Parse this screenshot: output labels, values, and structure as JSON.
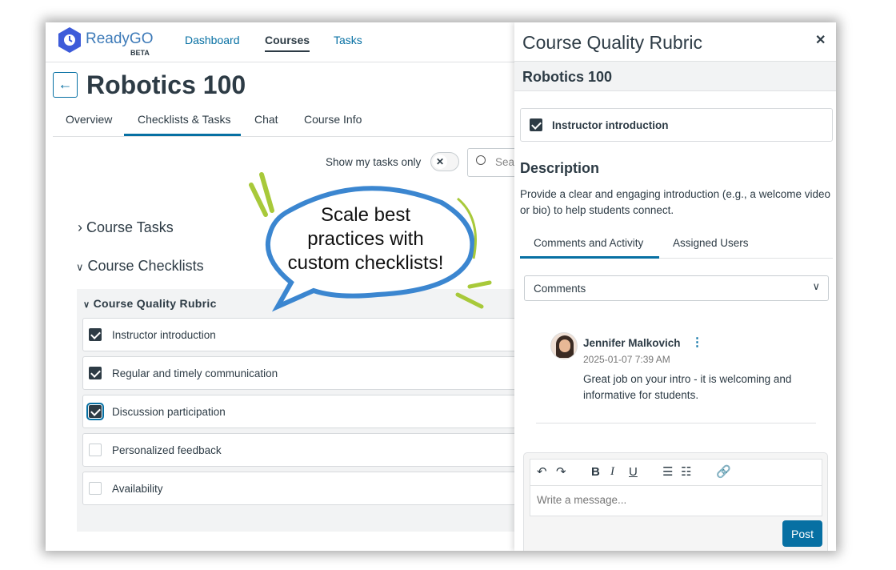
{
  "app": {
    "name": "ReadyGO",
    "badge": "BETA",
    "accent": "#0770a3"
  },
  "nav": [
    {
      "label": "Dashboard"
    },
    {
      "label": "Courses",
      "active": true
    },
    {
      "label": "Tasks"
    }
  ],
  "course": {
    "title": "Robotics 100",
    "back_icon": "arrow-left-icon"
  },
  "tabs": [
    {
      "label": "Overview"
    },
    {
      "label": "Checklists & Tasks",
      "active": true
    },
    {
      "label": "Chat"
    },
    {
      "label": "Course Info"
    }
  ],
  "filter": {
    "toggle_label": "Show my tasks only",
    "toggle_on": false,
    "search_placeholder": "Search"
  },
  "sections": {
    "tasks": "Course Tasks",
    "checklists": "Course Checklists"
  },
  "rubric": {
    "title": "Course Quality Rubric",
    "items": [
      {
        "label": "Instructor introduction",
        "checked": true
      },
      {
        "label": "Regular and timely communication",
        "checked": true
      },
      {
        "label": "Discussion participation",
        "checked": true
      },
      {
        "label": "Personalized feedback",
        "checked": false
      },
      {
        "label": "Availability",
        "checked": false
      }
    ]
  },
  "callout": {
    "line1": "Scale best",
    "line2": "practices with",
    "line3": "custom checklists!"
  },
  "panel": {
    "title": "Course Quality Rubric",
    "subtitle": "Robotics 100",
    "item": "Instructor introduction",
    "description_heading": "Description",
    "description_1": "Provide a clear and engaging introduction (e.g., a welcome video",
    "description_2": "or bio) to help students connect.",
    "tabs": [
      {
        "label": "Comments and Activity",
        "active": true
      },
      {
        "label": "Assigned Users"
      }
    ],
    "filter_select": "Comments",
    "comment": {
      "author": "Jennifer Malkovich",
      "time": "2025-01-07 7:39 AM",
      "text_1": "Great job on your intro - it is welcoming and",
      "text_2": "informative for students."
    },
    "editor": {
      "placeholder": "Write a message...",
      "post": "Post"
    }
  }
}
